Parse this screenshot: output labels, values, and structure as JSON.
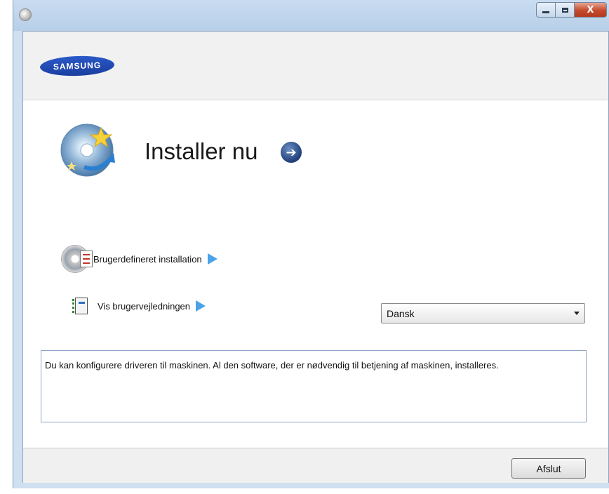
{
  "window": {
    "title": "",
    "minimize_glyph": "",
    "maximize_glyph": "",
    "close_glyph": "X"
  },
  "banner": {
    "logo_text": "SAMSUNG"
  },
  "main": {
    "install_now_label": "Installer nu",
    "custom_install_label": "Brugerdefineret installation",
    "user_guide_label": "Vis brugervejledningen",
    "language_select": {
      "selected": "Dansk"
    },
    "description": "Du kan konfigurere driveren til maskinen. Al den software, der er nødvendig til betjening af maskinen, installeres."
  },
  "footer": {
    "exit_label": "Afslut"
  },
  "icons": {
    "app": "samsung-cd-icon",
    "install": "install-disc-icon",
    "go": "arrow-right-circle-icon",
    "custom": "cd-checklist-icon",
    "guide": "user-guide-book-icon",
    "triangle": "play-triangle-icon"
  },
  "colors": {
    "title_bar": "#c9dcf0",
    "close_button": "#c44a2c",
    "logo_blue": "#1b3ea0",
    "link_arrow": "#4aa3e8"
  }
}
